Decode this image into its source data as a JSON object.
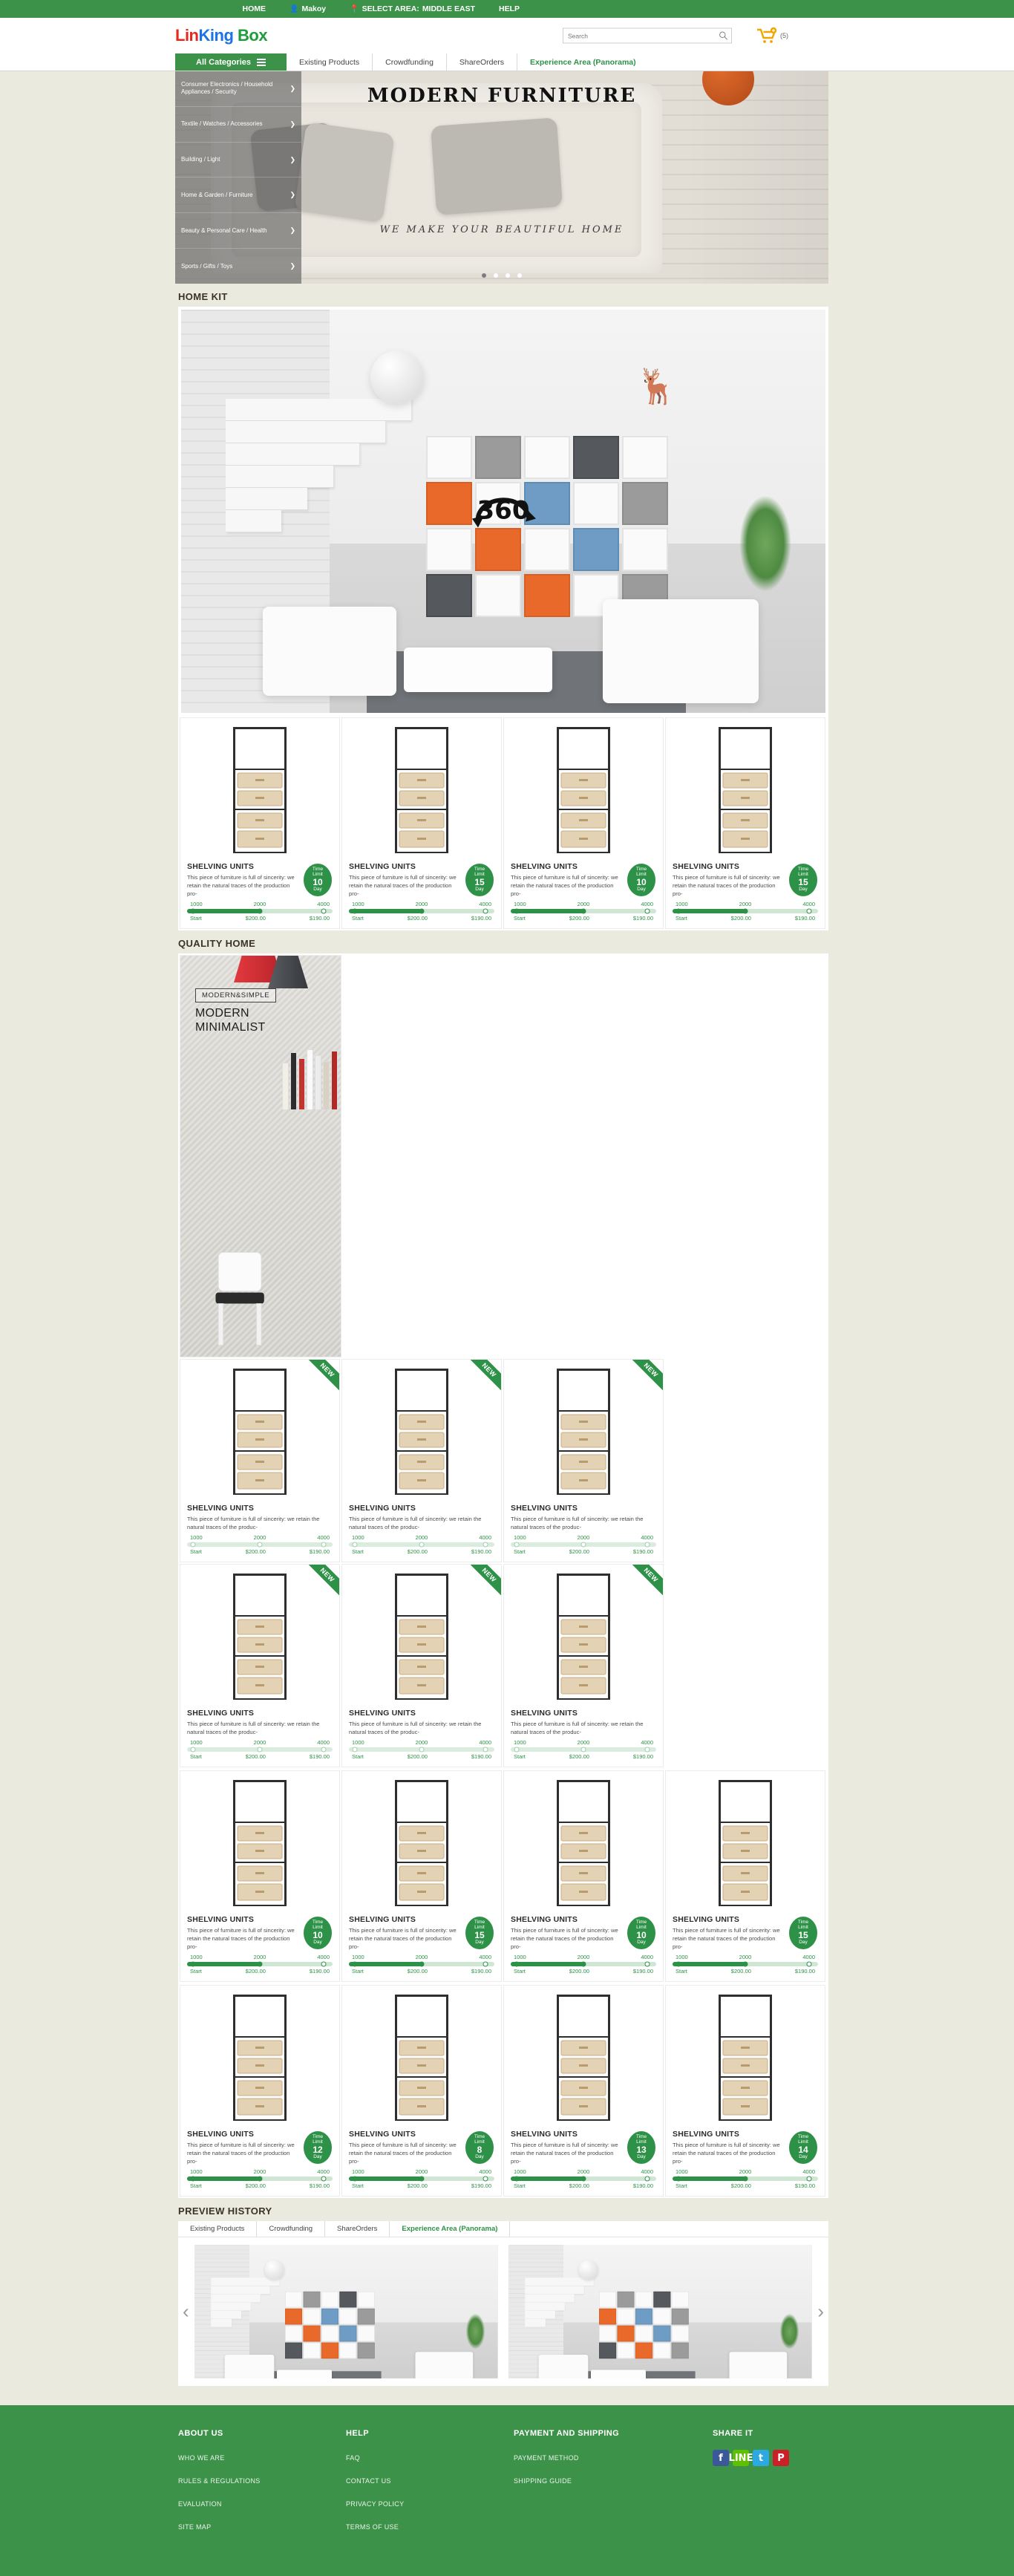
{
  "topbar": {
    "items": [
      {
        "label": "HOME",
        "icon": null
      },
      {
        "label": "Makoy",
        "icon": "user-icon"
      },
      {
        "label": "SELECT AREA:",
        "icon": "location-pin-icon",
        "value": "MIDDLE EAST"
      },
      {
        "label": "HELP",
        "icon": null
      }
    ]
  },
  "header": {
    "logo": {
      "part1": "Lin",
      "part2": "King",
      "part3": "Box"
    },
    "search": {
      "placeholder": "Search",
      "value": "",
      "icon": "search-icon"
    },
    "cart": {
      "icon": "cart-icon",
      "count": "(5)",
      "badge": "+"
    }
  },
  "nav": {
    "all_categories": "All Categories",
    "tabs": [
      {
        "label": "Existing Products",
        "active": false
      },
      {
        "label": "Crowdfunding",
        "active": false
      },
      {
        "label": "ShareOrders",
        "active": false
      },
      {
        "label": "Experience Area (Panorama)",
        "active": true
      }
    ]
  },
  "sidebar": {
    "items": [
      {
        "label": "Consumer Electronics / Household Appliances / Security"
      },
      {
        "label": "Textile / Watches / Accessories"
      },
      {
        "label": "Building / Light"
      },
      {
        "label": "Home & Garden / Furniture"
      },
      {
        "label": "Beauty & Personal Care / Health"
      },
      {
        "label": "Sports / Gifts / Toys"
      }
    ],
    "chevron": "chevron-right-icon"
  },
  "hero": {
    "title": "MODERN   FURNITURE",
    "subtitle": "WE MAKE YOUR BEAUTIFUL HOME",
    "dots": [
      true,
      false,
      false,
      false
    ]
  },
  "sections": {
    "home_kit": "HOME KIT",
    "quality_home": "QUALITY HOME",
    "preview_history": "PREVIEW HISTORY"
  },
  "panorama": {
    "badge": "360",
    "badge_icon": "rotate-360-icon"
  },
  "product_template": {
    "title": "SHELVING UNITS",
    "desc_narrow": "This piece of furniture is full of sincerity: we retain the natural traces of the production pro-",
    "desc_wide": "This piece of furniture is full of sincerity: we retain the natural traces of the produc-",
    "ticks": [
      "1000",
      "2000",
      "4000"
    ],
    "labels": [
      "Start",
      "$200.00",
      "$190.00"
    ],
    "time_label_top": "Time",
    "time_label_mid": "Limit",
    "time_label_bottom": "Day",
    "new_flag": "NEW"
  },
  "home_kit_products": [
    {
      "title": "SHELVING UNITS",
      "days": "10",
      "ticks": [
        "1000",
        "2000",
        "4000"
      ],
      "labels": [
        "Start",
        "$200.00",
        "$190.00"
      ],
      "new": false,
      "fill": 50
    },
    {
      "title": "SHELVING UNITS",
      "days": "15",
      "ticks": [
        "1000",
        "2000",
        "4000"
      ],
      "labels": [
        "Start",
        "$200.00",
        "$190.00"
      ],
      "new": false,
      "fill": 50
    },
    {
      "title": "SHELVING UNITS",
      "days": "10",
      "ticks": [
        "1000",
        "2000",
        "4000"
      ],
      "labels": [
        "Start",
        "$200.00",
        "$190.00"
      ],
      "new": false,
      "fill": 50
    },
    {
      "title": "SHELVING UNITS",
      "days": "15",
      "ticks": [
        "1000",
        "2000",
        "4000"
      ],
      "labels": [
        "Start",
        "$200.00",
        "$190.00"
      ],
      "new": false,
      "fill": 50
    }
  ],
  "quality_home_row1": [
    {
      "title": "SHELVING UNITS",
      "days": null,
      "ticks": [
        "1000",
        "2000",
        "4000"
      ],
      "labels": [
        "Start",
        "$200.00",
        "$190.00"
      ],
      "new": true,
      "fill": 0
    },
    {
      "title": "SHELVING UNITS",
      "days": null,
      "ticks": [
        "1000",
        "2000",
        "4000"
      ],
      "labels": [
        "Start",
        "$200.00",
        "$190.00"
      ],
      "new": true,
      "fill": 0
    },
    {
      "title": "SHELVING UNITS",
      "days": null,
      "ticks": [
        "1000",
        "2000",
        "4000"
      ],
      "labels": [
        "Start",
        "$200.00",
        "$190.00"
      ],
      "new": true,
      "fill": 0
    }
  ],
  "quality_home_row2": [
    {
      "title": "SHELVING UNITS",
      "days": null,
      "ticks": [
        "1000",
        "2000",
        "4000"
      ],
      "labels": [
        "Start",
        "$200.00",
        "$190.00"
      ],
      "new": true,
      "fill": 0
    },
    {
      "title": "SHELVING UNITS",
      "days": null,
      "ticks": [
        "1000",
        "2000",
        "4000"
      ],
      "labels": [
        "Start",
        "$200.00",
        "$190.00"
      ],
      "new": true,
      "fill": 0
    },
    {
      "title": "SHELVING UNITS",
      "days": null,
      "ticks": [
        "1000",
        "2000",
        "4000"
      ],
      "labels": [
        "Start",
        "$200.00",
        "$190.00"
      ],
      "new": true,
      "fill": 0
    }
  ],
  "quality_home_row3": [
    {
      "title": "SHELVING UNITS",
      "days": "10",
      "ticks": [
        "1000",
        "2000",
        "4000"
      ],
      "labels": [
        "Start",
        "$200.00",
        "$190.00"
      ],
      "new": false,
      "fill": 50
    },
    {
      "title": "SHELVING UNITS",
      "days": "15",
      "ticks": [
        "1000",
        "2000",
        "4000"
      ],
      "labels": [
        "Start",
        "$200.00",
        "$190.00"
      ],
      "new": false,
      "fill": 50
    },
    {
      "title": "SHELVING UNITS",
      "days": "10",
      "ticks": [
        "1000",
        "2000",
        "4000"
      ],
      "labels": [
        "Start",
        "$200.00",
        "$190.00"
      ],
      "new": false,
      "fill": 50
    },
    {
      "title": "SHELVING UNITS",
      "days": "15",
      "ticks": [
        "1000",
        "2000",
        "4000"
      ],
      "labels": [
        "Start",
        "$200.00",
        "$190.00"
      ],
      "new": false,
      "fill": 50
    }
  ],
  "quality_home_row4": [
    {
      "title": "SHELVING UNITS",
      "days": "12",
      "ticks": [
        "1000",
        "2000",
        "4000"
      ],
      "labels": [
        "Start",
        "$200.00",
        "$190.00"
      ],
      "new": false,
      "fill": 50
    },
    {
      "title": "SHELVING UNITS",
      "days": "8",
      "ticks": [
        "1000",
        "2000",
        "4000"
      ],
      "labels": [
        "Start",
        "$200.00",
        "$190.00"
      ],
      "new": false,
      "fill": 50
    },
    {
      "title": "SHELVING UNITS",
      "days": "13",
      "ticks": [
        "1000",
        "2000",
        "4000"
      ],
      "labels": [
        "Start",
        "$200.00",
        "$190.00"
      ],
      "new": false,
      "fill": 50
    },
    {
      "title": "SHELVING UNITS",
      "days": "14",
      "ticks": [
        "1000",
        "2000",
        "4000"
      ],
      "labels": [
        "Start",
        "$200.00",
        "$190.00"
      ],
      "new": false,
      "fill": 50
    }
  ],
  "feature_card": {
    "tag": "MODERN&SIMPLE",
    "heading_line1": "MODERN",
    "heading_line2": "MINIMALIST"
  },
  "preview_tabs": [
    {
      "label": "Existing Products",
      "active": false
    },
    {
      "label": "Crowdfunding",
      "active": false
    },
    {
      "label": "ShareOrders",
      "active": false
    },
    {
      "label": "Experience Area (Panorama)",
      "active": true
    }
  ],
  "carousel": {
    "prev": "‹",
    "next": "›"
  },
  "footer": {
    "columns": [
      {
        "title": "ABOUT US",
        "links": [
          "WHO WE ARE",
          "RULES & REGULATIONS",
          "EVALUATION",
          "SITE MAP"
        ]
      },
      {
        "title": "HELP",
        "links": [
          "FAQ",
          "CONTACT US",
          "PRIVACY POLICY",
          "TERMS OF USE"
        ]
      },
      {
        "title": "PAYMENT AND SHIPPING",
        "links": [
          "PAYMENT METHOD",
          "SHIPPING GUIDE"
        ]
      }
    ],
    "share": {
      "title": "SHARE IT",
      "icons": [
        {
          "name": "facebook-icon",
          "glyph": "f",
          "color": "#3b5998"
        },
        {
          "name": "line-icon",
          "glyph": "LINE",
          "color": "#5ec000"
        },
        {
          "name": "twitter-icon",
          "glyph": "t",
          "color": "#2ca9e1"
        },
        {
          "name": "pinterest-icon",
          "glyph": "P",
          "color": "#cb2027"
        }
      ]
    }
  },
  "colors": {
    "brand_green": "#3d9249",
    "accent_green": "#2e9148",
    "page_bg": "#eaeade"
  }
}
